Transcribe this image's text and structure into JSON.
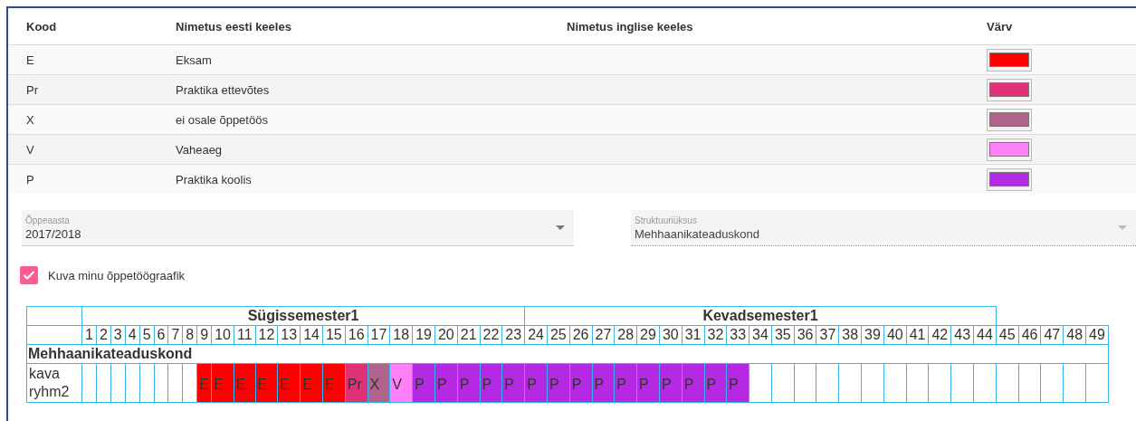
{
  "legend": {
    "columns": [
      "Kood",
      "Nimetus eesti keeles",
      "Nimetus inglise keeles",
      "Värv"
    ],
    "rows": [
      {
        "code": "E",
        "name_et": "Eksam",
        "color": "#ff0000"
      },
      {
        "code": "Pr",
        "name_et": "Praktika ettevõtes",
        "color": "#e03077"
      },
      {
        "code": "X",
        "name_et": "ei osale õppetöös",
        "color": "#b0648c"
      },
      {
        "code": "V",
        "name_et": "Vaheaeg",
        "color": "#ff80f8"
      },
      {
        "code": "P",
        "name_et": "Praktika koolis",
        "color": "#b529e4"
      }
    ]
  },
  "filters": [
    {
      "label": "Õppeaasta",
      "value": "2017/2018",
      "disabled": false
    },
    {
      "label": "Struktuuriüksus",
      "value": "Mehhaanikateaduskond",
      "disabled": true
    }
  ],
  "show_my_schedule": {
    "label": "Kuva minu õppetöögraafik",
    "checked": true
  },
  "schedule": {
    "semesters": [
      {
        "label": "Sügissemester1",
        "weeks": [
          "1",
          "2",
          "3",
          "4",
          "5",
          "6",
          "7",
          "8",
          "9",
          "10",
          "11",
          "12",
          "13",
          "14",
          "15",
          "16",
          "17",
          "18",
          "19",
          "20",
          "21",
          "22",
          "23"
        ]
      },
      {
        "label": "Kevadsemester1",
        "weeks": [
          "24",
          "25",
          "26",
          "27",
          "28",
          "29",
          "30",
          "31",
          "32",
          "33",
          "34",
          "35",
          "36",
          "37",
          "38",
          "39",
          "40",
          "41",
          "42",
          "43",
          "44"
        ]
      }
    ],
    "unassigned_weeks": [
      "45",
      "46",
      "47",
      "48",
      "49"
    ],
    "unit": "Mehhaanikateaduskond",
    "groups": [
      {
        "label": "kava ryhm2",
        "cells": [
          {
            "kind": "empty"
          },
          {
            "kind": "empty"
          },
          {
            "kind": "empty"
          },
          {
            "kind": "empty"
          },
          {
            "kind": "empty"
          },
          {
            "kind": "empty"
          },
          {
            "kind": "empty"
          },
          {
            "kind": "empty"
          },
          {
            "kind": "mark",
            "text": "E",
            "color": "#ff0000"
          },
          {
            "kind": "mark",
            "text": "E",
            "color": "#ff0000"
          },
          {
            "kind": "mark",
            "text": "E",
            "color": "#ff0000"
          },
          {
            "kind": "mark",
            "text": "E",
            "color": "#ff0000"
          },
          {
            "kind": "mark",
            "text": "E",
            "color": "#ff0000"
          },
          {
            "kind": "mark",
            "text": "E",
            "color": "#ff0000"
          },
          {
            "kind": "mark",
            "text": "E",
            "color": "#ff0000"
          },
          {
            "kind": "mark",
            "text": "Pr",
            "color": "#e03077"
          },
          {
            "kind": "mark",
            "text": "X",
            "color": "#b0648c"
          },
          {
            "kind": "mark",
            "text": "V",
            "color": "#ff80f8"
          },
          {
            "kind": "mark",
            "text": "P",
            "color": "#b529e4"
          },
          {
            "kind": "mark",
            "text": "P",
            "color": "#b529e4"
          },
          {
            "kind": "mark",
            "text": "P",
            "color": "#b529e4"
          },
          {
            "kind": "mark",
            "text": "P",
            "color": "#b529e4"
          },
          {
            "kind": "mark",
            "text": "P",
            "color": "#b529e4"
          },
          {
            "kind": "mark",
            "text": "P",
            "color": "#b529e4"
          },
          {
            "kind": "mark",
            "text": "P",
            "color": "#b529e4"
          },
          {
            "kind": "mark",
            "text": "P",
            "color": "#b529e4"
          },
          {
            "kind": "mark",
            "text": "P",
            "color": "#b529e4"
          },
          {
            "kind": "mark",
            "text": "P",
            "color": "#b529e4"
          },
          {
            "kind": "mark",
            "text": "P",
            "color": "#b529e4"
          },
          {
            "kind": "mark",
            "text": "P",
            "color": "#b529e4"
          },
          {
            "kind": "mark",
            "text": "P",
            "color": "#b529e4"
          },
          {
            "kind": "mark",
            "text": "P",
            "color": "#b529e4"
          },
          {
            "kind": "mark",
            "text": "P",
            "color": "#b529e4"
          },
          {
            "kind": "empty"
          },
          {
            "kind": "empty"
          },
          {
            "kind": "empty"
          },
          {
            "kind": "empty"
          },
          {
            "kind": "empty"
          },
          {
            "kind": "empty"
          },
          {
            "kind": "empty"
          },
          {
            "kind": "empty"
          },
          {
            "kind": "empty"
          },
          {
            "kind": "empty"
          },
          {
            "kind": "empty"
          },
          {
            "kind": "empty"
          },
          {
            "kind": "empty"
          },
          {
            "kind": "empty"
          },
          {
            "kind": "empty"
          },
          {
            "kind": "empty"
          }
        ]
      }
    ]
  }
}
